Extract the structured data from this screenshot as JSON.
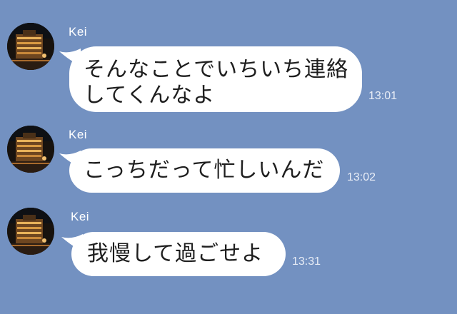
{
  "chat": {
    "background": "#7391c1",
    "messages": [
      {
        "sender": "Kei",
        "lines": [
          "そんなことでいちいち連絡",
          "してくんなよ"
        ],
        "time": "13:01"
      },
      {
        "sender": "Kei",
        "lines": [
          "こっちだって忙しいんだ"
        ],
        "time": "13:02"
      },
      {
        "sender": "Kei",
        "lines": [
          "我慢して過ごせよ"
        ],
        "time": "13:31"
      }
    ]
  }
}
